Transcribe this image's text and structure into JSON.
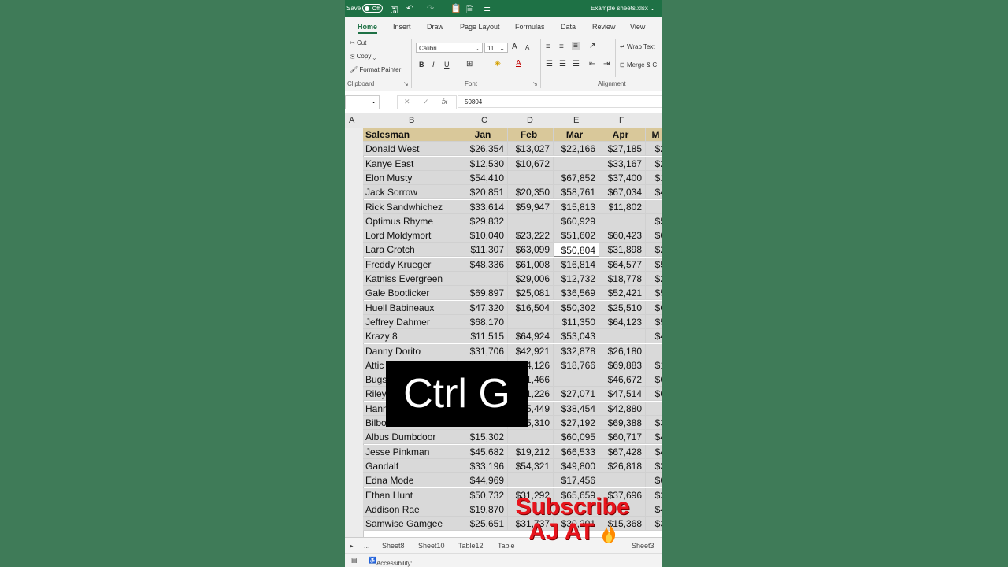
{
  "titlebar": {
    "autosave_label": "Save",
    "toggle_state": "Off",
    "filename": "Example sheets.xlsx"
  },
  "ribbon_tabs": [
    "Home",
    "Insert",
    "Draw",
    "Page Layout",
    "Formulas",
    "Data",
    "Review",
    "View"
  ],
  "clipboard": {
    "cut": "Cut",
    "copy": "Copy",
    "format_painter": "Format Painter",
    "group_label": "Clipboard"
  },
  "font": {
    "name": "Calibri",
    "size": "11",
    "group_label": "Font",
    "bold": "B",
    "italic": "I",
    "underline": "U",
    "grow": "A",
    "shrink": "A"
  },
  "alignment": {
    "wrap_text": "Wrap Text",
    "merge": "Merge & C",
    "group_label": "Alignment"
  },
  "formula_bar": {
    "value": "50804",
    "cancel": "✕",
    "enter": "✓",
    "fx": "fx"
  },
  "column_headers": [
    "A",
    "B",
    "C",
    "D",
    "E",
    "F"
  ],
  "table": {
    "headers": [
      "Salesman",
      "Jan",
      "Feb",
      "Mar",
      "Apr",
      "M"
    ],
    "rows": [
      [
        "Donald West",
        "$26,354",
        "$13,027",
        "$22,166",
        "$27,185",
        "$2"
      ],
      [
        "Kanye East",
        "$12,530",
        "$10,672",
        "",
        "$33,167",
        "$2"
      ],
      [
        "Elon Musty",
        "$54,410",
        "",
        "$67,852",
        "$37,400",
        "$1"
      ],
      [
        "Jack Sorrow",
        "$20,851",
        "$20,350",
        "$58,761",
        "$67,034",
        "$4"
      ],
      [
        "Rick Sandwhichez",
        "$33,614",
        "$59,947",
        "$15,813",
        "$11,802",
        ""
      ],
      [
        "Optimus Rhyme",
        "$29,832",
        "",
        "$60,929",
        "",
        "$5"
      ],
      [
        "Lord Moldymort",
        "$10,040",
        "$23,222",
        "$51,602",
        "$60,423",
        "$6"
      ],
      [
        "Lara Crotch",
        "$11,307",
        "$63,099",
        "$50,804",
        "$31,898",
        "$2"
      ],
      [
        "Freddy Krueger",
        "$48,336",
        "$61,008",
        "$16,814",
        "$64,577",
        "$5"
      ],
      [
        "Katniss Evergreen",
        "",
        "$29,006",
        "$12,732",
        "$18,778",
        "$2"
      ],
      [
        "Gale Bootlicker",
        "$69,897",
        "$25,081",
        "$36,569",
        "$52,421",
        "$5"
      ],
      [
        "Huell Babineaux",
        "$47,320",
        "$16,504",
        "$50,302",
        "$25,510",
        "$6"
      ],
      [
        "Jeffrey Dahmer",
        "$68,170",
        "",
        "$11,350",
        "$64,123",
        "$5"
      ],
      [
        "Krazy 8",
        "$11,515",
        "$64,924",
        "$53,043",
        "",
        "$4"
      ],
      [
        "Danny Dorito",
        "$31,706",
        "$42,921",
        "$32,878",
        "$26,180",
        ""
      ],
      [
        "Attic",
        "",
        "$4,126",
        "$18,766",
        "$69,883",
        "$1"
      ],
      [
        "Bugs",
        "",
        "$1,466",
        "",
        "$46,672",
        "$6"
      ],
      [
        "Riley",
        "",
        "$1,226",
        "$27,071",
        "$47,514",
        "$6"
      ],
      [
        "Hann",
        "",
        "$5,449",
        "$38,454",
        "$42,880",
        ""
      ],
      [
        "Bilbo",
        "",
        "$5,310",
        "$27,192",
        "$69,388",
        "$3"
      ],
      [
        "Albus Dumbdoor",
        "$15,302",
        "",
        "$60,095",
        "$60,717",
        "$4"
      ],
      [
        "Jesse Pinkman",
        "$45,682",
        "$19,212",
        "$66,533",
        "$67,428",
        "$4"
      ],
      [
        "Gandalf",
        "$33,196",
        "$54,321",
        "$49,800",
        "$26,818",
        "$3"
      ],
      [
        "Edna Mode",
        "$44,969",
        "",
        "$17,456",
        "",
        "$6"
      ],
      [
        "Ethan Hunt",
        "$50,732",
        "$31,292",
        "$65,659",
        "$37,696",
        "$2"
      ],
      [
        "Addison Rae",
        "$19,870",
        "",
        "",
        "",
        "$4"
      ],
      [
        "Samwise Gamgee",
        "$25,651",
        "$31,737",
        "$30,201",
        "$15,368",
        "$3"
      ]
    ]
  },
  "overlay": {
    "shortcut": "Ctrl G",
    "subscribe_line1": "Subscribe",
    "subscribe_line2": "AJ AT"
  },
  "sheet_tabs": [
    "...",
    "Sheet8",
    "Sheet10",
    "Table12",
    "Table",
    "Sheet3"
  ],
  "status_bar": {
    "accessibility": "Accessibility: Investigate"
  },
  "colors": {
    "excel_green": "#1e7145",
    "header_fill": "#d9c89a",
    "subscribe_red": "#e8141c"
  }
}
